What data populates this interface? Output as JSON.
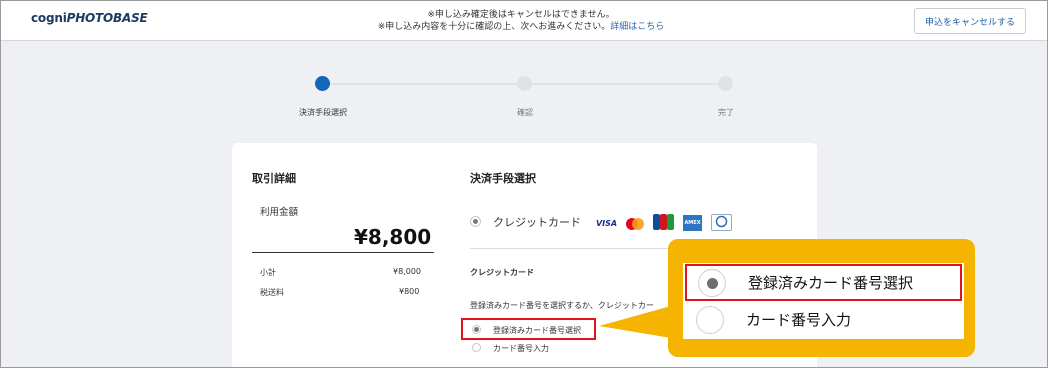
{
  "header": {
    "logo_bold": "cogni",
    "logo_italic": "PHOTOBASE",
    "notice_line1": "※申し込み確定後はキャンセルはできません。",
    "notice_line2": "※申し込み内容を十分に確認の上、次へお進みください。",
    "notice_link": "詳細はこちら",
    "cancel_label": "申込をキャンセルする"
  },
  "steps": [
    {
      "label": "決済手段選択",
      "active": true
    },
    {
      "label": "確認",
      "active": false
    },
    {
      "label": "完了",
      "active": false
    }
  ],
  "transaction": {
    "title": "取引詳細",
    "usage_label": "利用金額",
    "usage_amount": "¥8,800",
    "subtotal_label": "小計",
    "subtotal_value": "¥8,000",
    "shipping_label": "税送料",
    "shipping_value": "¥800"
  },
  "payment": {
    "title": "決済手段選択",
    "method_label": "クレジットカード",
    "brands": [
      "VISA",
      "mastercard",
      "JCB",
      "AMEX",
      "Diners Club"
    ],
    "credit_title": "クレジットカード",
    "instruction": "登録済みカード番号を選択するか、クレジットカー",
    "option_registered": "登録済みカード番号選択",
    "option_input": "カード番号入力"
  },
  "callout": {
    "option_registered": "登録済みカード番号選択",
    "option_input": "カード番号入力"
  },
  "colors": {
    "accent": "#1466b8",
    "highlight_red": "#e0141d",
    "callout_yellow": "#f5b400",
    "background": "#eef0f4"
  }
}
